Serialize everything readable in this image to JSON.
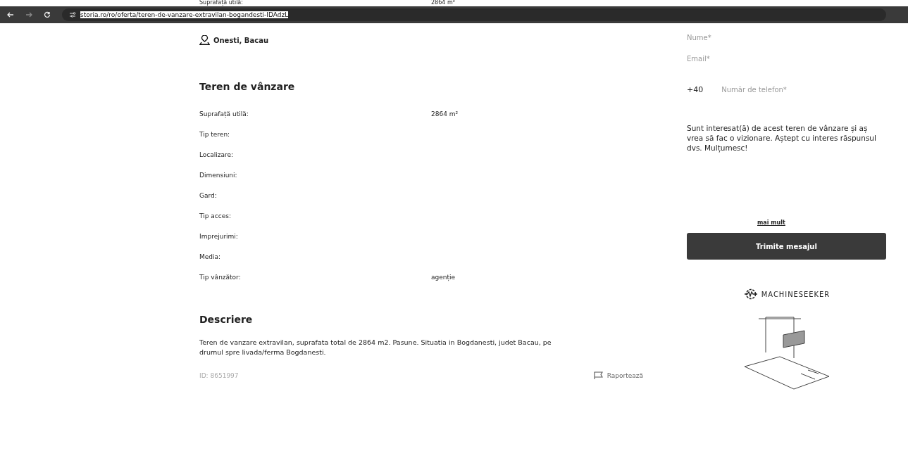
{
  "top_strip": {
    "label": "Suprafață utilă:",
    "value": "2864 m²"
  },
  "browser": {
    "url": "storia.ro/ro/oferta/teren-de-vanzare-extravilan-bogandesti-IDAdzL",
    "url_selected": true
  },
  "location": "Onesti, Bacau",
  "details": {
    "title": "Teren de vânzare",
    "rows": [
      {
        "label": "Suprafață utilă:",
        "value": "2864 m²"
      },
      {
        "label": "Tip teren:"
      },
      {
        "label": "Localizare:"
      },
      {
        "label": "Dimensiuni:"
      },
      {
        "label": "Gard:"
      },
      {
        "label": "Tip acces:"
      },
      {
        "label": "Imprejurimi:"
      },
      {
        "label": "Media:"
      },
      {
        "label": "Tip vânzător:",
        "value": "agenție"
      }
    ]
  },
  "description": {
    "title": "Descriere",
    "text": "Teren de vanzare extravilan, suprafata total de 2864 m2. Pasune. Situatia in Bogdanesti, judet Bacau, pe drumul spre livada/ferma Bogdanesti."
  },
  "footer": {
    "id": "ID: 8651997",
    "report": "Raportează"
  },
  "contact_form": {
    "name_placeholder": "Nume*",
    "email_placeholder": "Email*",
    "phone_prefix": "+40",
    "phone_placeholder": "Număr de telefon*",
    "message": "Sunt interesat(ă) de acest teren de vânzare și aș vrea să fac o vizionare. Aștept cu interes răspunsul dvs. Mulțumesc!",
    "more_link": "mai mult",
    "submit": "Trimite mesajul"
  },
  "ad": {
    "brand": "MACHINESEEKER"
  }
}
